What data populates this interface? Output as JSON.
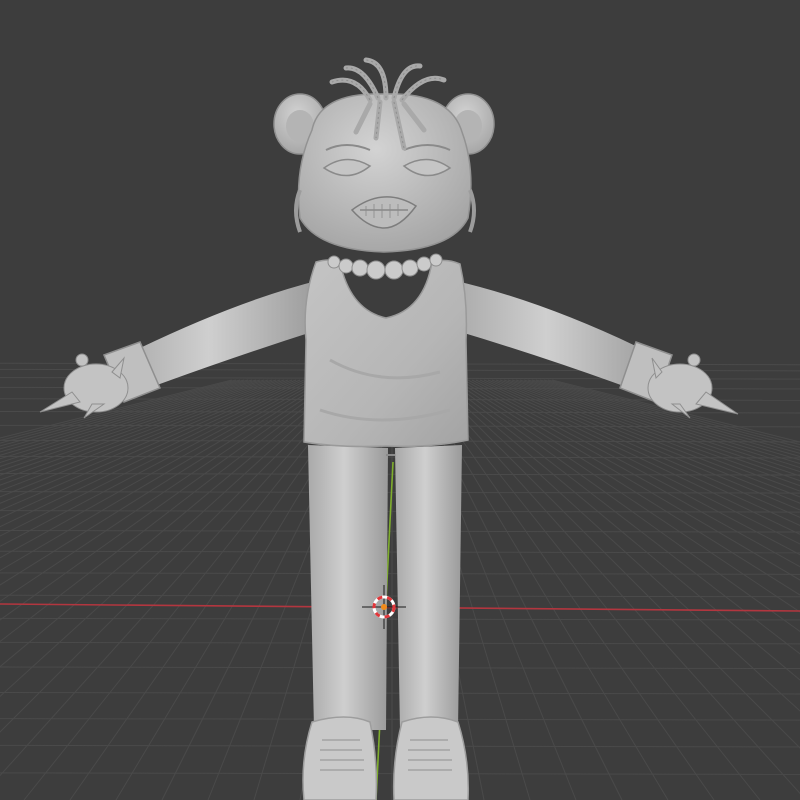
{
  "viewport": {
    "background": "#3d3d3d",
    "grid_color": "#4a4a4a",
    "x_axis_color": "#b3363f",
    "y_axis_color": "#7fae2d",
    "model_color": "#bdbdbd",
    "model_shadow": "#8e8e8e",
    "model_highlight": "#d9d9d9",
    "cursor_ring_colors": [
      "#ffffff",
      "#e2363a"
    ],
    "origin_dot_color": "#f08a1a"
  }
}
